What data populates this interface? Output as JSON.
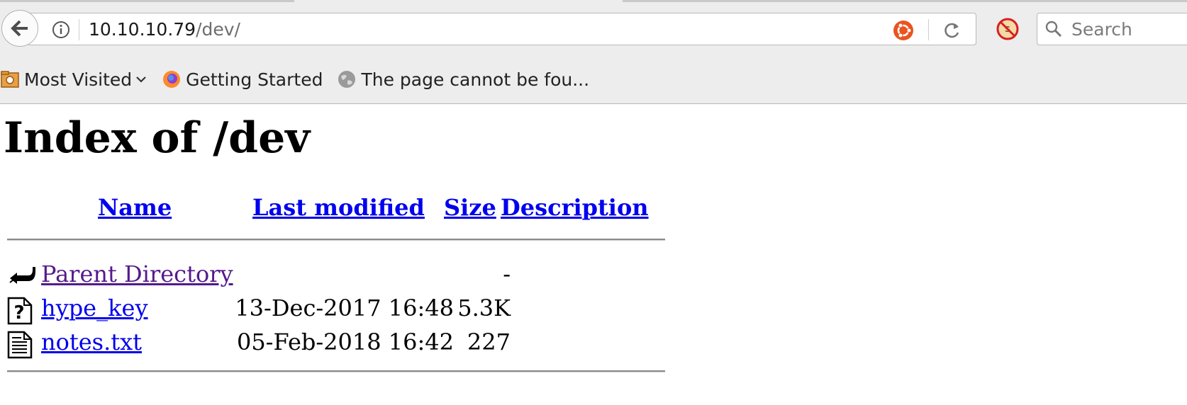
{
  "browser": {
    "url_host": "10.10.10.79",
    "url_path": "/dev/",
    "search_placeholder": "Search",
    "icons": {
      "back": "back-arrow-icon",
      "info": "info-icon",
      "ubuntu": "ubuntu-icon",
      "reload": "reload-icon",
      "noscript": "noscript-icon",
      "search": "search-icon"
    },
    "bookmarks": [
      {
        "label": "Most Visited",
        "icon": "most-visited-icon",
        "has_dropdown": true
      },
      {
        "label": "Getting Started",
        "icon": "firefox-icon"
      },
      {
        "label": "The page cannot be fou...",
        "icon": "globe-icon"
      }
    ]
  },
  "page": {
    "title": "Index of /dev",
    "columns": {
      "name": "Name",
      "last_modified": "Last modified",
      "size": "Size",
      "description": "Description"
    },
    "rows": [
      {
        "name": "Parent Directory",
        "modified": "",
        "size": "-",
        "icon": "back-folder-icon",
        "visited": true
      },
      {
        "name": "hype_key",
        "modified": "13-Dec-2017 16:48",
        "size": "5.3K",
        "icon": "unknown-file-icon",
        "visited": false
      },
      {
        "name": "notes.txt",
        "modified": "05-Feb-2018 16:42",
        "size": "227",
        "icon": "text-file-icon",
        "visited": false
      }
    ]
  },
  "colors": {
    "link": "#0000ee",
    "visited": "#551a8b",
    "chrome_bg": "#ededed",
    "ubuntu_orange": "#e95420"
  }
}
